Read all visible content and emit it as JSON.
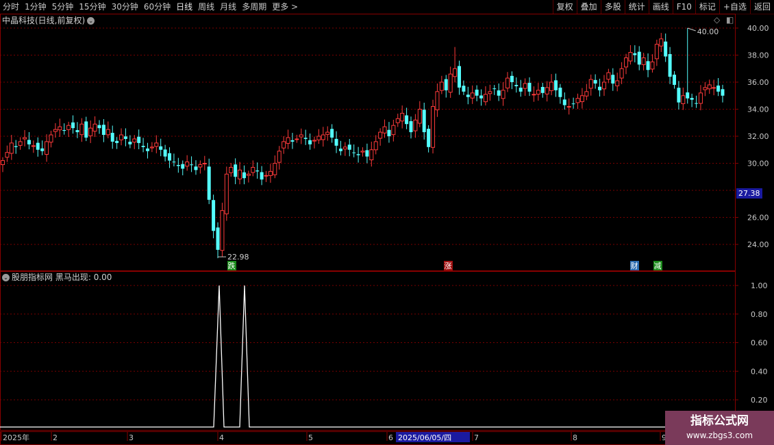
{
  "toolbar": {
    "periods": [
      "分时",
      "1分钟",
      "5分钟",
      "15分钟",
      "30分钟",
      "60分钟",
      "日线",
      "周线",
      "月线",
      "多周期",
      "更多 >"
    ],
    "active_period": "日线",
    "right_buttons": [
      "复权",
      "叠加",
      "多股",
      "统计",
      "画线",
      "F10",
      "标记",
      "+自选",
      "返回"
    ]
  },
  "main_chart": {
    "title": "中晶科技(日线,前复权)",
    "y_axis_labels": [
      "40.00",
      "38.00",
      "36.00",
      "34.00",
      "32.00",
      "30.00",
      "26.00",
      "24.00"
    ],
    "current_price_tag": "27.38",
    "high_annotation": "40.00",
    "low_annotation": "22.98",
    "event_markers": [
      {
        "label": "跌",
        "color": "#1a8a1a"
      },
      {
        "label": "涨",
        "color": "#a01010"
      },
      {
        "label": "财",
        "color": "#2a6ab0"
      },
      {
        "label": "减",
        "color": "#1a8a1a"
      }
    ],
    "up_color": "#ff3b3b",
    "down_color": "#54ffff"
  },
  "indicator": {
    "title_name": "股朋指标网",
    "title_series": "黑马出现: 0.00",
    "y_axis_labels": [
      "1.00",
      "0.80",
      "0.60",
      "0.40",
      "0.20"
    ]
  },
  "x_axis": {
    "labels": [
      "2025年",
      "2",
      "3",
      "4",
      "5",
      "6",
      "7",
      "8",
      "9"
    ],
    "cursor_date": "2025/06/05/四"
  },
  "watermark": {
    "line1": "指标公式网",
    "line2": "www.zbgs3.com"
  },
  "chart_data": {
    "type": "candlestick",
    "title": "中晶科技(日线,前复权)",
    "ylim": [
      22.5,
      41.0
    ],
    "price_high": 40.0,
    "price_low": 22.98,
    "indicator_series": {
      "name": "黑马出现",
      "spikes_value": 1.0,
      "baseline": 0.0
    }
  }
}
